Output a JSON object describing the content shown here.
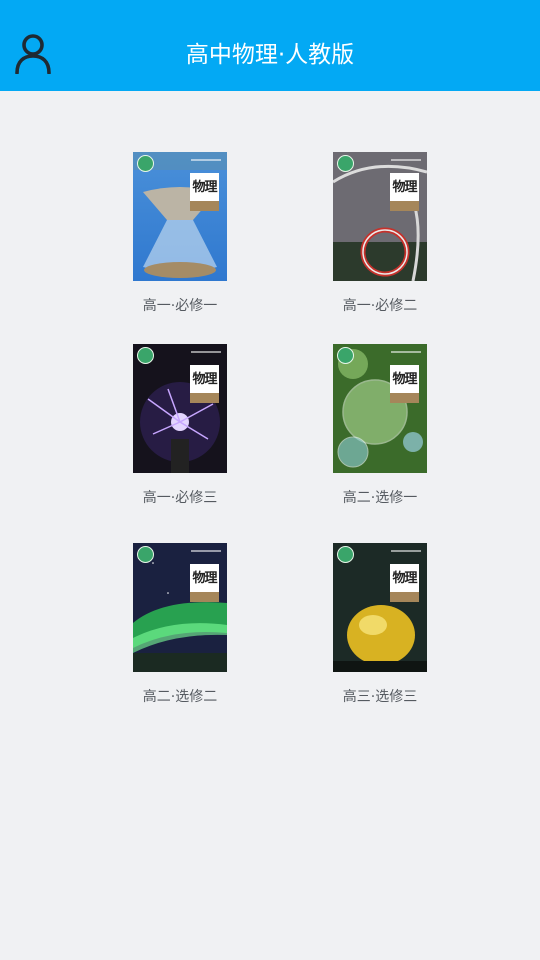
{
  "header": {
    "title": "高中物理·人教版",
    "user_icon": "user-icon",
    "background": "#03a9f4"
  },
  "cover_title": "物理",
  "books": [
    {
      "label": "高一·必修一",
      "art": "hourglass"
    },
    {
      "label": "高一·必修二",
      "art": "roller-coaster"
    },
    {
      "label": "高一·必修三",
      "art": "plasma-ball"
    },
    {
      "label": "高二·选修一",
      "art": "soap-bubbles"
    },
    {
      "label": "高二·选修二",
      "art": "aurora"
    },
    {
      "label": "高三·选修三",
      "art": "golden-sphere"
    }
  ]
}
